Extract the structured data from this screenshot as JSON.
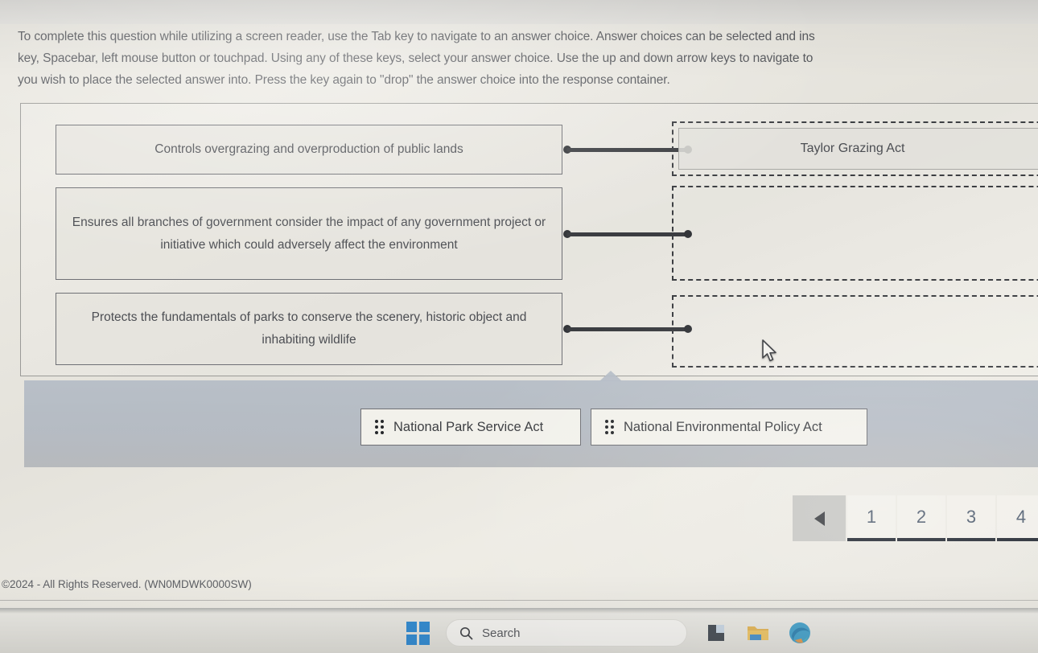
{
  "instructions": {
    "line1": "To complete this question while utilizing a screen reader, use the Tab key to navigate to an answer choice. Answer choices can be selected and ins",
    "line2": "key, Spacebar, left mouse button or touchpad. Using any of these keys, select your answer choice. Use the up and down arrow keys to navigate to",
    "line3": "you wish to place the selected answer into. Press the key again to \"drop\" the answer choice into the response container."
  },
  "question": {
    "prompts": [
      {
        "text": "Controls overgrazing and overproduction of public lands"
      },
      {
        "text": "Ensures all branches of government consider the impact of any government project or initiative which could adversely affect the environment"
      },
      {
        "text": "Protects the fundamentals of parks to conserve the scenery, historic object and inhabiting wildlife"
      }
    ],
    "drop_zones": [
      {
        "filled": true,
        "answer": "Taylor Grazing Act"
      },
      {
        "filled": false,
        "answer": ""
      },
      {
        "filled": false,
        "answer": ""
      }
    ],
    "choices": [
      {
        "label": "National Park Service Act",
        "handle_icon": "drag-grip-icon"
      },
      {
        "label": "National Environmental Policy Act",
        "handle_icon": "drag-grip-icon"
      }
    ]
  },
  "pagination": {
    "prev_icon": "triangle-left-icon",
    "pages": [
      "1",
      "2",
      "3",
      "4"
    ]
  },
  "footer": {
    "copyright": "©2024 - All Rights Reserved. (WN0MDWK0000SW)"
  },
  "taskbar": {
    "start_icon": "windows-start-icon",
    "search_icon": "search-icon",
    "search_placeholder": "Search",
    "apps": [
      {
        "icon": "widgets-icon"
      },
      {
        "icon": "file-explorer-icon"
      },
      {
        "icon": "edge-browser-icon"
      }
    ]
  },
  "colors": {
    "tray": "#b3bcc8",
    "accent_blue": "#2a8fe0",
    "text": "#4c4e54",
    "connector": "#33353a"
  }
}
